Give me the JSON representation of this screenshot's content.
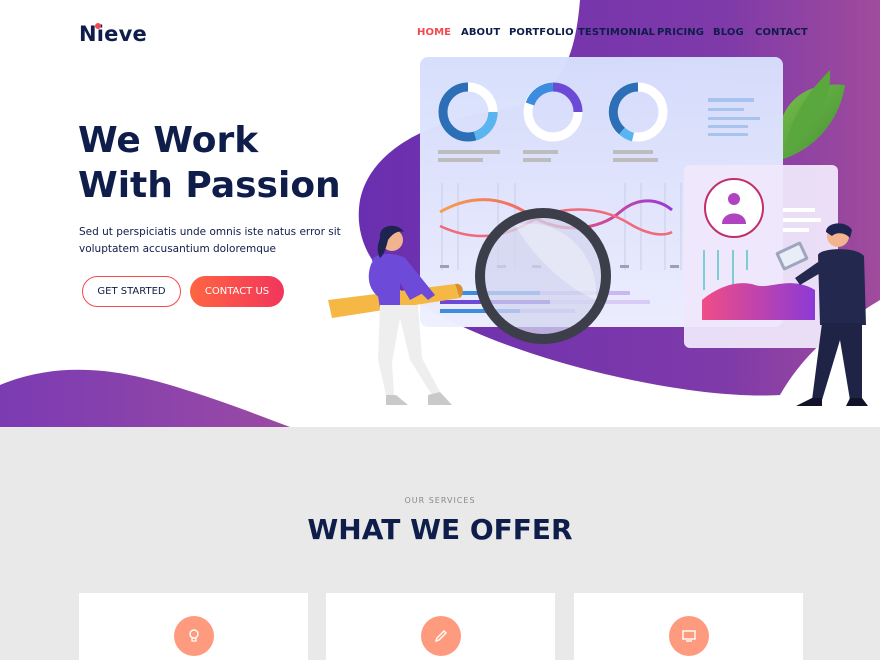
{
  "brand": {
    "logo": "Nieve"
  },
  "nav": {
    "items": [
      {
        "label": "HOME",
        "active": true
      },
      {
        "label": "ABOUT"
      },
      {
        "label": "PORTFOLIO"
      },
      {
        "label": "TESTIMONIAL"
      },
      {
        "label": "PRICING"
      },
      {
        "label": "BLOG"
      },
      {
        "label": "CONTACT"
      }
    ]
  },
  "hero": {
    "title_line1": "We Work",
    "title_line2": "With Passion",
    "text": "Sed ut perspiciatis unde omnis iste natus error sit voluptatem accusantium doloremque",
    "btn_primary": "GET STARTED",
    "btn_secondary": "CONTACT US"
  },
  "services": {
    "subtitle": "OUR SERVICES",
    "title": "WHAT WE OFFER",
    "cards": [
      {
        "icon": "lightbulb-icon"
      },
      {
        "icon": "pencil-icon"
      },
      {
        "icon": "monitor-icon"
      }
    ]
  },
  "colors": {
    "accent": "#f7484e",
    "navy": "#0e1d4a",
    "purple": "#7b3bb3",
    "services_bg": "#e9e9e9"
  }
}
